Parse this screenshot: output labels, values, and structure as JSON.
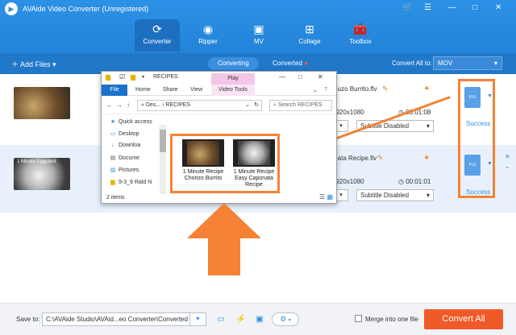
{
  "app": {
    "title": "AVAide Video Converter (Unregistered)"
  },
  "window_controls": {
    "cart": "🛒",
    "menu": "☰",
    "minimize": "—",
    "maximize": "□",
    "close": "✕"
  },
  "nav": {
    "tabs": [
      {
        "label": "Converter",
        "icon": "⟳"
      },
      {
        "label": "Ripper",
        "icon": "◉"
      },
      {
        "label": "MV",
        "icon": "▣"
      },
      {
        "label": "Collage",
        "icon": "⊞"
      },
      {
        "label": "Toolbox",
        "icon": "🧰"
      }
    ]
  },
  "subbar": {
    "add_files": "Add Files",
    "converting": "Converting",
    "converted": "Converted",
    "convert_all_label": "Convert All to:",
    "format": "MOV"
  },
  "files": [
    {
      "name": "...uzo Burrito.flv",
      "resolution": "1920x1080",
      "duration": "00:01:08",
      "subtitle": "Subtitle Disabled",
      "status": "Success",
      "thumb_text": ""
    },
    {
      "name": "...ata Recipe.flv",
      "resolution": "1920x1080",
      "duration": "00:01:01",
      "subtitle": "Subtitle Disabled",
      "status": "Success",
      "thumb_text": "1 Minute Eggplant"
    }
  ],
  "output_icon_label": "FLV",
  "explorer": {
    "title": "RECIPES",
    "play_tab": "Play",
    "ribbon": {
      "file": "File",
      "home": "Home",
      "share": "Share",
      "view": "View",
      "video_tools": "Video Tools"
    },
    "address": "« Des... › RECIPES",
    "search_placeholder": "Search RECIPES",
    "sidebar": [
      "Quick access",
      "Desktop",
      "Downloa",
      "Docume",
      "Pictures",
      "9-3_9 Rald N"
    ],
    "items": [
      {
        "caption": "1 Minute Recipe Chorizo Burrito"
      },
      {
        "caption": "1 Minute Recipe Easy Caponata Recipe"
      }
    ],
    "item_count": "2 items"
  },
  "bottom": {
    "save_to": "Save to:",
    "path": "C:\\AVAide Studio\\AVAid...eo Converter\\Converted",
    "merge": "Merge into one file",
    "convert_all": "Convert All"
  },
  "colors": {
    "accent": "#2a8ee3",
    "highlight": "#f58235",
    "convert_button": "#f05a28"
  }
}
